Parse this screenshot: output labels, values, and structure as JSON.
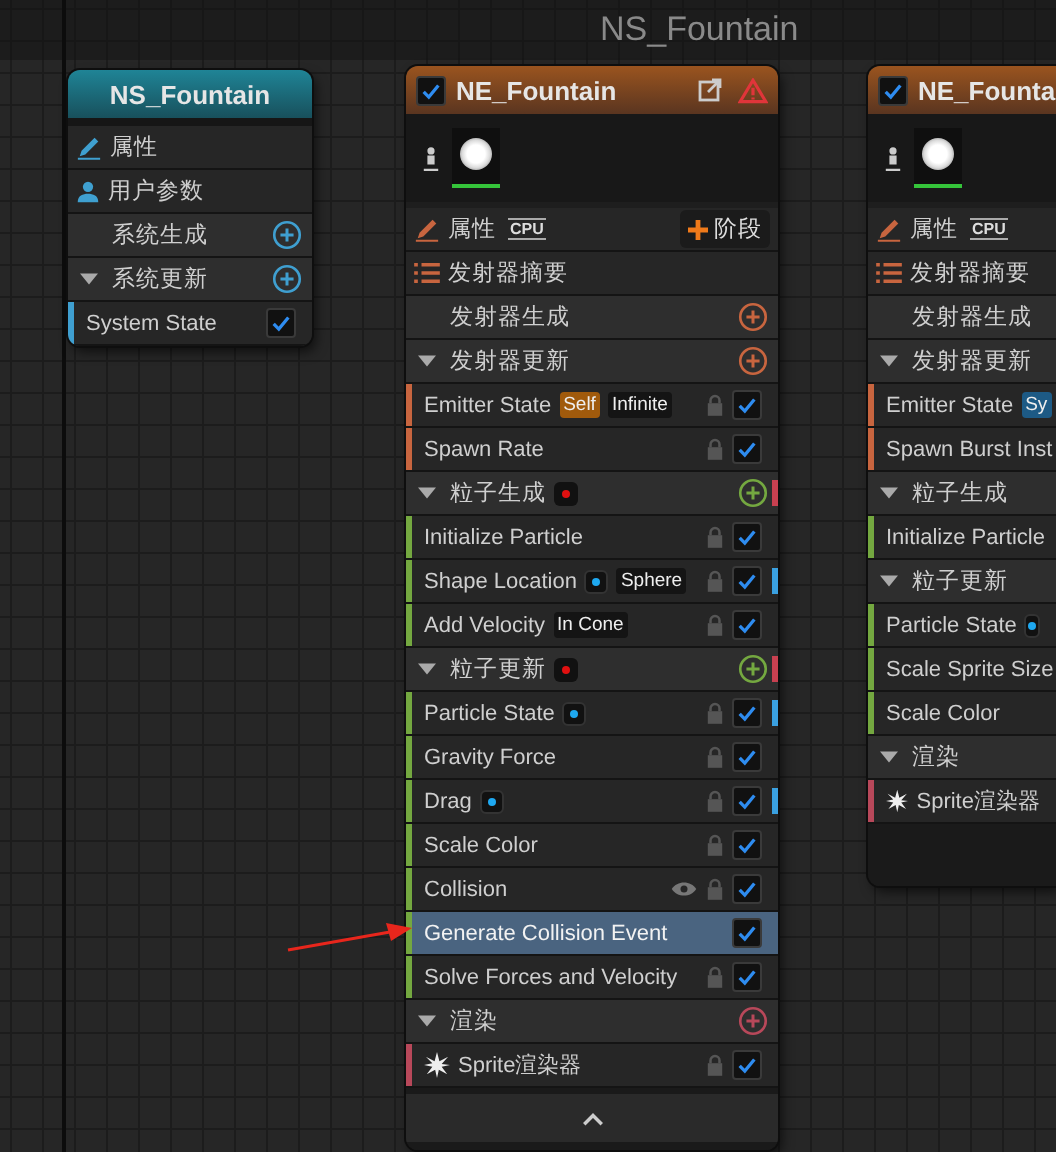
{
  "graph_title": "NS_Fountain",
  "nodes": [
    {
      "kind": "system",
      "title": "NS_Fountain",
      "rows": [
        {
          "kind": "properties",
          "label": "属性"
        },
        {
          "kind": "user-params",
          "label": "用户参数"
        },
        {
          "kind": "stage",
          "label": "系统生成",
          "color": "#3f9fd0",
          "modules": []
        },
        {
          "kind": "stage",
          "label": "系统更新",
          "color": "#3f9fd0",
          "expanded": true,
          "modules": [
            {
              "name": "System State",
              "checked": true,
              "selected": false
            }
          ]
        }
      ]
    },
    {
      "kind": "emitter",
      "title": "NE_Fountain",
      "enabled": true,
      "warning": true,
      "collapse_button": true,
      "rows": [
        {
          "kind": "preview"
        },
        {
          "kind": "properties",
          "label": "属性",
          "sim_tag": "CPU",
          "add_label": "阶段"
        },
        {
          "kind": "summary",
          "label": "发射器摘要"
        },
        {
          "kind": "stage",
          "label": "发射器生成",
          "color": "#c8653f",
          "modules": []
        },
        {
          "kind": "stage",
          "label": "发射器更新",
          "color": "#c8653f",
          "expanded": true,
          "modules": [
            {
              "name": "Emitter State",
              "checked": true,
              "locked": true,
              "selected": false,
              "badges": [
                {
                  "kind": "tag",
                  "text": "Self",
                  "color": "#a05a0c"
                },
                {
                  "kind": "tag",
                  "text": "Infinite",
                  "color": "#141414"
                }
              ]
            },
            {
              "name": "Spawn Rate",
              "checked": true,
              "locked": true,
              "selected": false
            }
          ]
        },
        {
          "kind": "stage",
          "label": "粒子生成",
          "color": "#74a840",
          "expanded": true,
          "error": true,
          "flag": true,
          "modules": [
            {
              "name": "Initialize Particle",
              "checked": true,
              "locked": true,
              "selected": false
            },
            {
              "name": "Shape Location",
              "checked": true,
              "locked": true,
              "selected": false,
              "flag": true,
              "badges": [
                {
                  "kind": "dot"
                },
                {
                  "kind": "tag",
                  "text": "Sphere",
                  "color": "#141414"
                }
              ]
            },
            {
              "name": "Add Velocity",
              "checked": true,
              "locked": true,
              "selected": false,
              "badges": [
                {
                  "kind": "tag",
                  "text": "In Cone",
                  "color": "#141414"
                }
              ]
            }
          ]
        },
        {
          "kind": "stage",
          "label": "粒子更新",
          "color": "#74a840",
          "expanded": true,
          "error": true,
          "flag": true,
          "modules": [
            {
              "name": "Particle State",
              "checked": true,
              "locked": true,
              "selected": false,
              "flag": true,
              "badges": [
                {
                  "kind": "dot"
                }
              ]
            },
            {
              "name": "Gravity Force",
              "checked": true,
              "locked": true,
              "selected": false
            },
            {
              "name": "Drag",
              "checked": true,
              "locked": true,
              "selected": false,
              "flag": true,
              "badges": [
                {
                  "kind": "dot"
                }
              ]
            },
            {
              "name": "Scale Color",
              "checked": true,
              "locked": true,
              "selected": false
            },
            {
              "name": "Collision",
              "checked": true,
              "locked": true,
              "visible": true,
              "selected": false
            },
            {
              "name": "Generate Collision Event",
              "checked": true,
              "selected": true
            },
            {
              "name": "Solve Forces and Velocity",
              "checked": true,
              "locked": true,
              "selected": false
            }
          ]
        },
        {
          "kind": "stage",
          "label": "渲染",
          "color": "#b8485a",
          "expanded": true,
          "modules": [
            {
              "name": "Sprite渲染器",
              "kind": "renderer",
              "checked": true,
              "locked": true,
              "selected": false
            }
          ]
        }
      ]
    },
    {
      "kind": "emitter",
      "title": "NE_Founta",
      "enabled": true,
      "collapse_button": false,
      "rows": [
        {
          "kind": "preview"
        },
        {
          "kind": "properties",
          "label": "属性",
          "sim_tag": "CPU"
        },
        {
          "kind": "summary",
          "label": "发射器摘要"
        },
        {
          "kind": "stage",
          "label": "发射器生成",
          "modules": []
        },
        {
          "kind": "stage",
          "label": "发射器更新",
          "color": "#c8653f",
          "expanded": true,
          "modules": [
            {
              "name": "Emitter State",
              "selected": false,
              "badges": [
                {
                  "kind": "tag",
                  "text": "Sy",
                  "color": "#1d5a85"
                }
              ]
            },
            {
              "name": "Spawn Burst Inst",
              "selected": false
            }
          ]
        },
        {
          "kind": "stage",
          "label": "粒子生成",
          "color": "#74a840",
          "expanded": true,
          "modules": [
            {
              "name": "Initialize Particle",
              "selected": false
            }
          ]
        },
        {
          "kind": "stage",
          "label": "粒子更新",
          "color": "#74a840",
          "expanded": true,
          "modules": [
            {
              "name": "Particle State",
              "selected": false,
              "badges": [
                {
                  "kind": "dot"
                }
              ]
            },
            {
              "name": "Scale Sprite Size",
              "selected": false
            },
            {
              "name": "Scale Color",
              "selected": false
            }
          ]
        },
        {
          "kind": "stage",
          "label": "渲染",
          "color": "#b8485a",
          "expanded": true,
          "modules": [
            {
              "name": "Sprite渲染器",
              "kind": "renderer",
              "selected": false
            }
          ]
        }
      ]
    }
  ],
  "annotation": {
    "kind": "arrow",
    "color": "#e8261c"
  }
}
